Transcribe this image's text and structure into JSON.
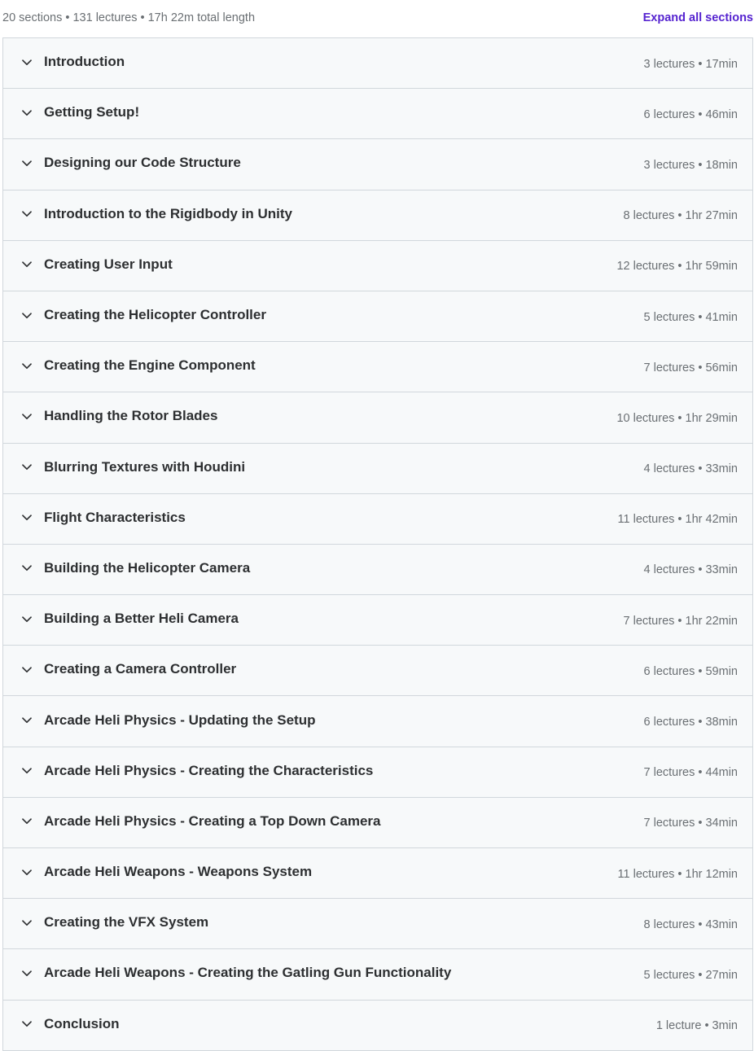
{
  "header": {
    "summary": "20 sections • 131 lectures • 17h 22m total length",
    "expand_all": "Expand all sections"
  },
  "sections": [
    {
      "title": "Introduction",
      "meta": "3 lectures • 17min"
    },
    {
      "title": "Getting Setup!",
      "meta": "6 lectures • 46min"
    },
    {
      "title": "Designing our Code Structure",
      "meta": "3 lectures • 18min"
    },
    {
      "title": "Introduction to the Rigidbody in Unity",
      "meta": "8 lectures • 1hr 27min"
    },
    {
      "title": "Creating User Input",
      "meta": "12 lectures • 1hr 59min"
    },
    {
      "title": "Creating the Helicopter Controller",
      "meta": "5 lectures • 41min"
    },
    {
      "title": "Creating the Engine Component",
      "meta": "7 lectures • 56min"
    },
    {
      "title": "Handling the Rotor Blades",
      "meta": "10 lectures • 1hr 29min"
    },
    {
      "title": "Blurring Textures with Houdini",
      "meta": "4 lectures • 33min"
    },
    {
      "title": "Flight Characteristics",
      "meta": "11 lectures • 1hr 42min"
    },
    {
      "title": "Building the Helicopter Camera",
      "meta": "4 lectures • 33min"
    },
    {
      "title": "Building a Better Heli Camera",
      "meta": "7 lectures • 1hr 22min"
    },
    {
      "title": "Creating a Camera Controller",
      "meta": "6 lectures • 59min"
    },
    {
      "title": "Arcade Heli Physics - Updating the Setup",
      "meta": "6 lectures • 38min"
    },
    {
      "title": "Arcade Heli Physics - Creating the Characteristics",
      "meta": "7 lectures • 44min"
    },
    {
      "title": "Arcade Heli Physics - Creating a Top Down Camera",
      "meta": "7 lectures • 34min"
    },
    {
      "title": "Arcade Heli Weapons - Weapons System",
      "meta": "11 lectures • 1hr 12min"
    },
    {
      "title": "Creating the VFX System",
      "meta": "8 lectures • 43min"
    },
    {
      "title": "Arcade Heli Weapons - Creating the Gatling Gun Functionality",
      "meta": "5 lectures • 27min"
    },
    {
      "title": "Conclusion",
      "meta": "1 lecture • 3min"
    }
  ],
  "icons": {
    "chevron": "chevron-down-icon"
  },
  "colors": {
    "accent": "#5624d0",
    "row_bg": "#f7f9fa",
    "border": "#d1d7dc",
    "text": "#2d2f31",
    "muted": "#6a6f73"
  }
}
